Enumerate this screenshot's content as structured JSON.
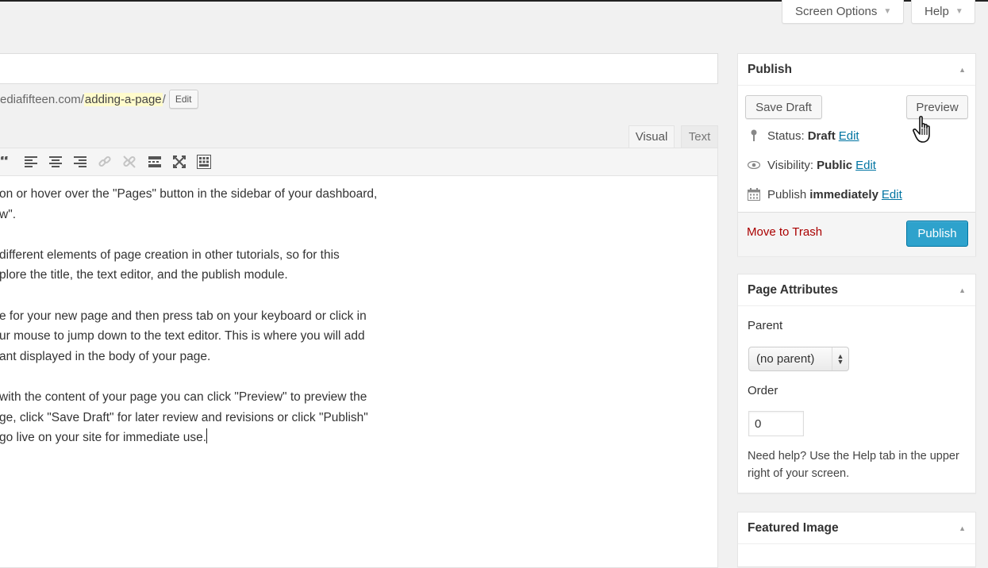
{
  "screen_meta": {
    "screen_options_label": "Screen Options",
    "help_label": "Help",
    "arrow": "▼"
  },
  "permalink": {
    "base": "ediafifteen.com/",
    "slug": "adding-a-page",
    "trail": "/",
    "edit_label": "Edit"
  },
  "editor": {
    "tabs": {
      "visual": "Visual",
      "text": "Text"
    },
    "toolbar_icons": [
      "blockquote-icon",
      "align-left-icon",
      "align-center-icon",
      "align-right-icon",
      "insert-link-icon",
      "remove-link-icon",
      "read-more-icon",
      "fullscreen-icon",
      "toolbar-toggle-icon"
    ],
    "paragraphs": [
      [
        "on or hover over the \"Pages\" button in the sidebar of your dashboard,",
        "w\"."
      ],
      [
        "different elements of page creation in other tutorials, so for this",
        "plore the title, the text editor, and the publish module."
      ],
      [
        "e for your new page and then press tab on your keyboard or click in",
        "ur mouse to jump down to the text editor. This is where you will add",
        "ant displayed in the body of your page."
      ],
      [
        "with the content of your page you can click \"Preview\" to preview the",
        "ge, click \"Save Draft\" for later review and revisions or click \"Publish\"",
        "go live on your site for immediate use."
      ]
    ]
  },
  "publish": {
    "title": "Publish",
    "save_draft": "Save Draft",
    "preview": "Preview",
    "status_label": "Status:",
    "status_value": "Draft",
    "visibility_label": "Visibility:",
    "visibility_value": "Public",
    "schedule_label": "Publish",
    "schedule_value": "immediately",
    "edit_link": "Edit",
    "trash": "Move to Trash",
    "publish_button": "Publish"
  },
  "page_attributes": {
    "title": "Page Attributes",
    "parent_label": "Parent",
    "parent_value": "(no parent)",
    "order_label": "Order",
    "order_value": "0",
    "help_text": "Need help? Use the Help tab in the upper right of your screen."
  },
  "featured_image": {
    "title": "Featured Image"
  },
  "colors": {
    "primary": "#2ea2cc",
    "link": "#0074a2",
    "trash": "#aa0000",
    "slug_highlight": "#fffbcc"
  }
}
